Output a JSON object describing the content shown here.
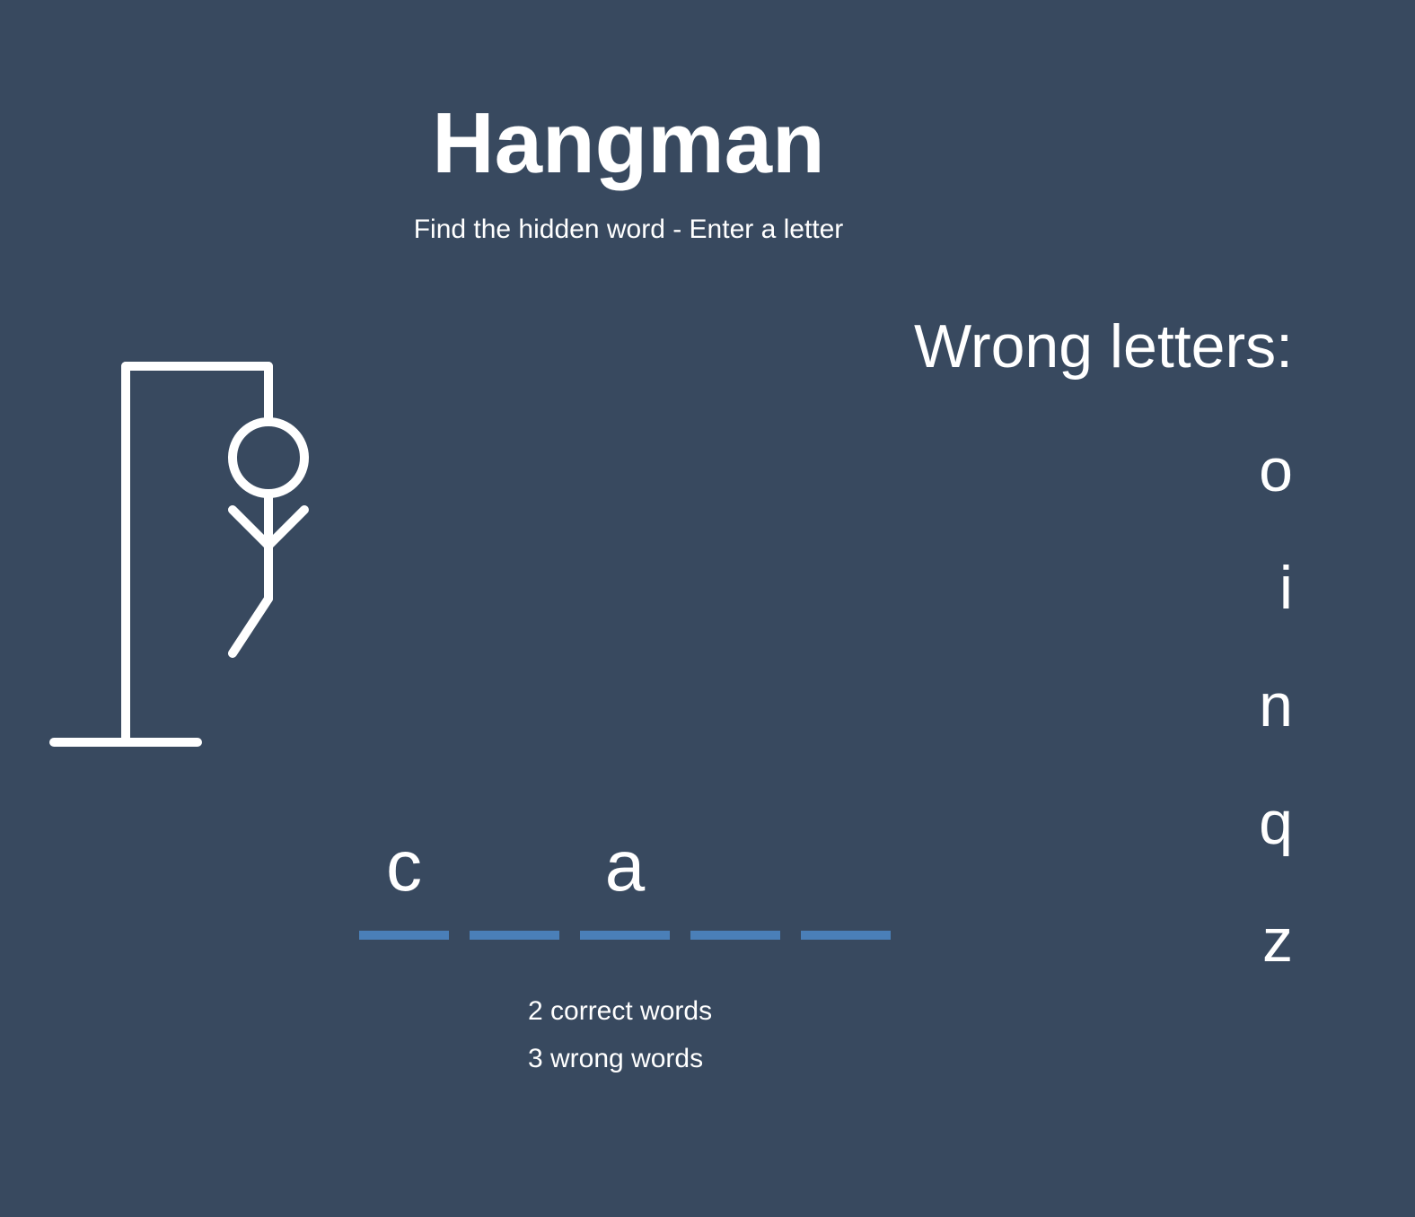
{
  "header": {
    "title": "Hangman",
    "subtitle": "Find the hidden word - Enter a letter"
  },
  "hangman_figure": {
    "parts_drawn": [
      "gallows",
      "head",
      "body",
      "left-arm",
      "right-arm",
      "left-leg"
    ],
    "wrong_guesses": 5
  },
  "wrong_letters": {
    "title": "Wrong letters:",
    "letters": [
      "o",
      "i",
      "n",
      "q",
      "z"
    ]
  },
  "word": {
    "slots": [
      "c",
      "",
      "a",
      "",
      ""
    ]
  },
  "stats": {
    "correct": "2 correct words",
    "wrong": "3 wrong words"
  },
  "colors": {
    "background": "#38495f",
    "text": "#ffffff",
    "slot_underline": "#4a7fb8"
  }
}
